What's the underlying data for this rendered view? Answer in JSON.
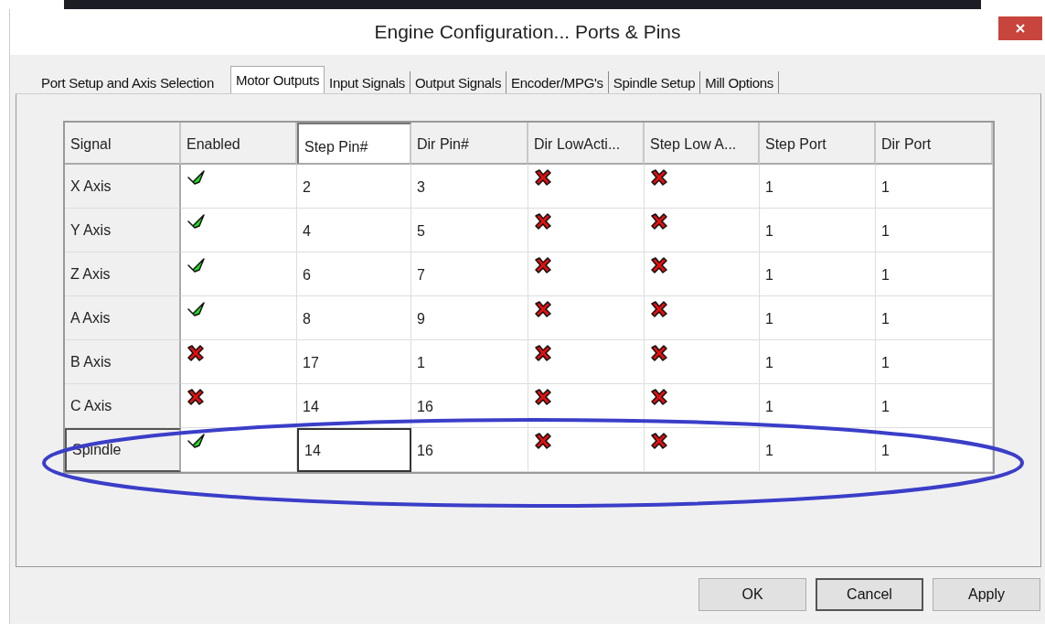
{
  "window": {
    "title": "Engine Configuration... Ports & Pins"
  },
  "tabs": [
    {
      "label": "Port Setup and Axis Selection",
      "selected": false
    },
    {
      "label": "Motor Outputs",
      "selected": true
    },
    {
      "label": "Input Signals",
      "selected": false
    },
    {
      "label": "Output Signals",
      "selected": false
    },
    {
      "label": "Encoder/MPG's",
      "selected": false
    },
    {
      "label": "Spindle Setup",
      "selected": false
    },
    {
      "label": "Mill Options",
      "selected": false
    }
  ],
  "table": {
    "columns": [
      {
        "label": "Signal",
        "kind": "label",
        "selected": false
      },
      {
        "label": "Enabled",
        "kind": "flag",
        "selected": false
      },
      {
        "label": "Step Pin#",
        "kind": "text",
        "selected": true
      },
      {
        "label": "Dir Pin#",
        "kind": "text",
        "selected": false
      },
      {
        "label": "Dir LowActi...",
        "kind": "flag",
        "selected": false
      },
      {
        "label": "Step Low A...",
        "kind": "flag",
        "selected": false
      },
      {
        "label": "Step Port",
        "kind": "text",
        "selected": false
      },
      {
        "label": "Dir Port",
        "kind": "text",
        "selected": false
      }
    ],
    "rows": [
      {
        "selected": false,
        "cells": [
          "X Axis",
          true,
          "2",
          "3",
          false,
          false,
          "1",
          "1"
        ]
      },
      {
        "selected": false,
        "cells": [
          "Y Axis",
          true,
          "4",
          "5",
          false,
          false,
          "1",
          "1"
        ]
      },
      {
        "selected": false,
        "cells": [
          "Z Axis",
          true,
          "6",
          "7",
          false,
          false,
          "1",
          "1"
        ]
      },
      {
        "selected": false,
        "cells": [
          "A Axis",
          true,
          "8",
          "9",
          false,
          false,
          "1",
          "1"
        ]
      },
      {
        "selected": false,
        "cells": [
          "B Axis",
          false,
          "17",
          "1",
          false,
          false,
          "1",
          "1"
        ]
      },
      {
        "selected": false,
        "cells": [
          "C Axis",
          false,
          "14",
          "16",
          false,
          false,
          "1",
          "1"
        ]
      },
      {
        "selected": true,
        "cells": [
          "Spindle",
          true,
          "14",
          "16",
          false,
          false,
          "1",
          "1"
        ]
      }
    ]
  },
  "buttons": [
    "OK",
    "Cancel",
    "Apply"
  ]
}
